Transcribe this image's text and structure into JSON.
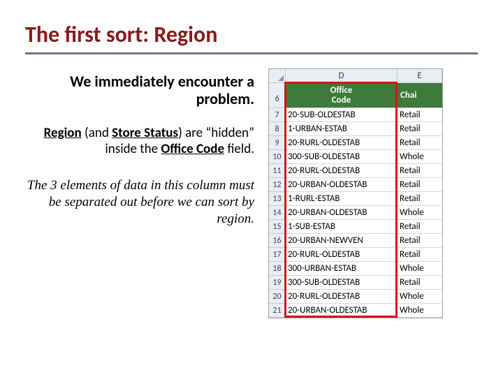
{
  "title": "The first sort: Region",
  "p1": "We immediately encounter a problem.",
  "p2": {
    "seg1": "Region",
    "seg2": " (and ",
    "seg3": "Store Status",
    "seg4": ") are “hidden” inside the ",
    "seg5": "Office Code",
    "seg6": " field."
  },
  "p3": "The 3 elements of data in this column must be separated out before we can sort by region.",
  "excel": {
    "col_D": "D",
    "col_E": "E",
    "header_row_num": "6",
    "header_office": "Office\nCode",
    "header_channel": "Chai",
    "rows": [
      {
        "n": "7",
        "d": "20-SUB-OLDESTAB",
        "e": "Retail"
      },
      {
        "n": "8",
        "d": "1-URBAN-ESTAB",
        "e": "Retail"
      },
      {
        "n": "9",
        "d": "20-RURL-OLDESTAB",
        "e": "Retail"
      },
      {
        "n": "10",
        "d": "300-SUB-OLDESTAB",
        "e": "Whole"
      },
      {
        "n": "11",
        "d": "20-RURL-OLDESTAB",
        "e": "Retail"
      },
      {
        "n": "12",
        "d": "20-URBAN-OLDESTAB",
        "e": "Retail"
      },
      {
        "n": "13",
        "d": "1-RURL-ESTAB",
        "e": "Retail"
      },
      {
        "n": "14",
        "d": "20-URBAN-OLDESTAB",
        "e": "Whole"
      },
      {
        "n": "15",
        "d": "1-SUB-ESTAB",
        "e": "Retail"
      },
      {
        "n": "16",
        "d": "20-URBAN-NEWVEN",
        "e": "Retail"
      },
      {
        "n": "17",
        "d": "20-RURL-OLDESTAB",
        "e": "Retail"
      },
      {
        "n": "18",
        "d": "300-URBAN-ESTAB",
        "e": "Whole"
      },
      {
        "n": "19",
        "d": "300-SUB-OLDESTAB",
        "e": "Retail"
      },
      {
        "n": "20",
        "d": "20-RURL-OLDESTAB",
        "e": "Whole"
      },
      {
        "n": "21",
        "d": "20-URBAN-OLDESTAB",
        "e": "Whole"
      }
    ]
  }
}
